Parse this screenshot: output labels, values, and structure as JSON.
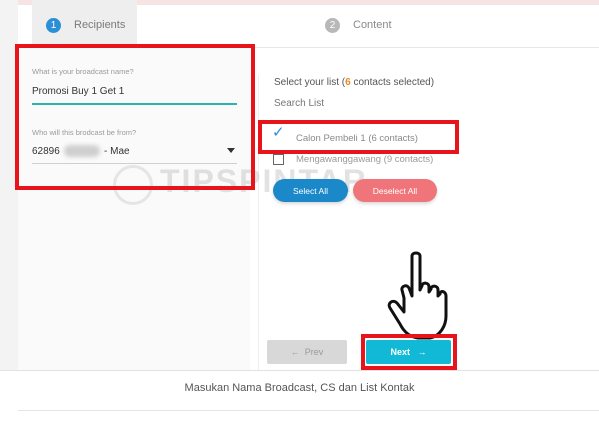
{
  "steps": [
    {
      "number": "1",
      "label": "Recipients"
    },
    {
      "number": "2",
      "label": "Content"
    }
  ],
  "form": {
    "broadcast_name_label": "What is your broadcast name?",
    "broadcast_name_value": "Promosi Buy 1 Get 1",
    "sender_label": "Who will this brodcast be from?",
    "sender_prefix": "62896",
    "sender_suffix": "- Mae"
  },
  "lists": {
    "title_prefix": "Select your list (",
    "selected_count": "6",
    "title_suffix": " contacts selected)",
    "search_placeholder": "Search List",
    "items": [
      {
        "label": "Calon Pembeli 1 (6 contacts)",
        "checked": true
      },
      {
        "label": "Mengawanggawang (9 contacts)",
        "checked": false
      }
    ],
    "select_all_label": "Select All",
    "deselect_all_label": "Deselect All"
  },
  "nav": {
    "prev_label": "Prev",
    "next_label": "Next",
    "prev_arrow": "←",
    "next_arrow": "→"
  },
  "watermark": "TIPSPINTAR",
  "caption": "Masukan Nama Broadcast, CS dan List Kontak",
  "colors": {
    "accent_blue": "#2a8fd6",
    "highlight_red": "#e8141b",
    "teal": "#12b9d6",
    "deselect_pink": "#f0757a",
    "count_orange": "#e58a2a"
  }
}
